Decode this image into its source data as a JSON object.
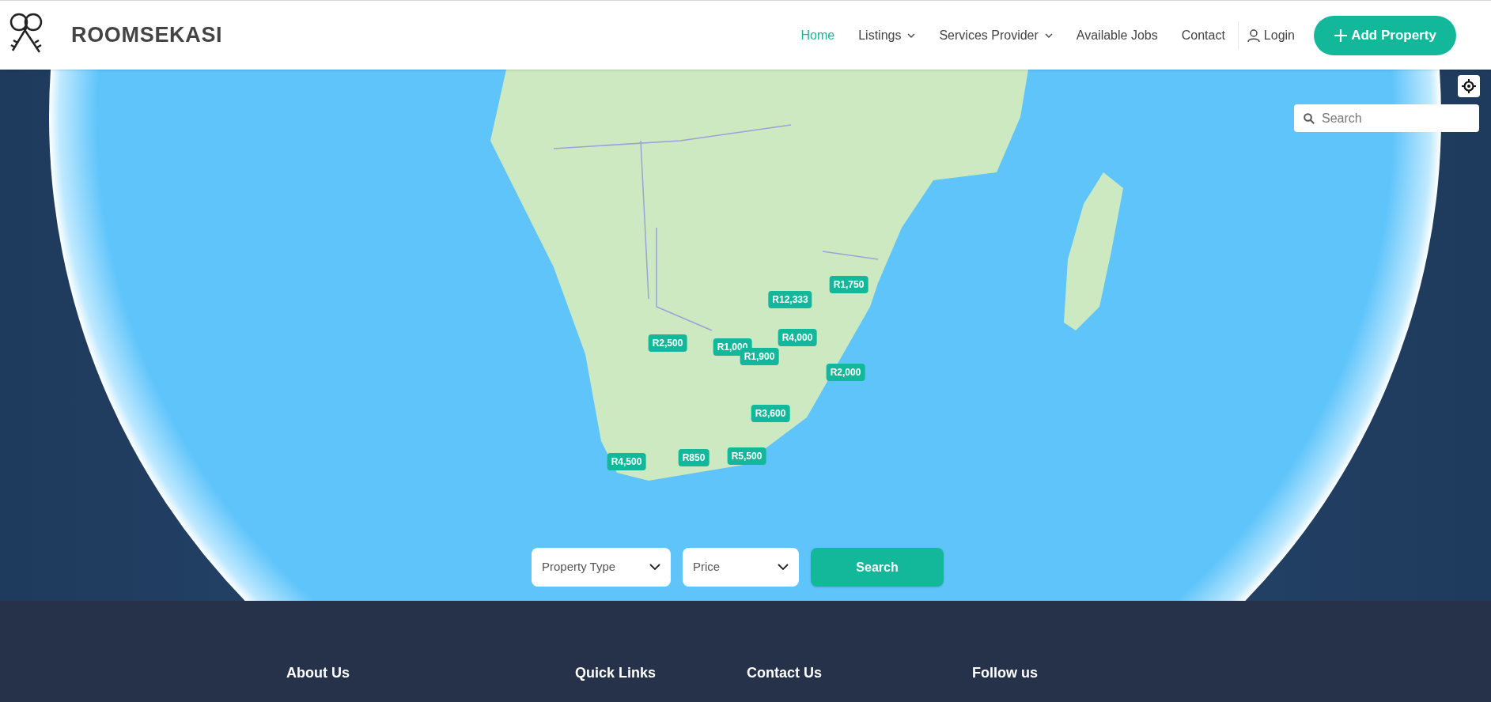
{
  "header": {
    "brand": "ROOMSEKASI",
    "nav": [
      {
        "label": "Home",
        "selected": true,
        "dropdown": false
      },
      {
        "label": "Listings",
        "selected": false,
        "dropdown": true
      },
      {
        "label": "Services Provider",
        "selected": false,
        "dropdown": true
      },
      {
        "label": "Available Jobs",
        "selected": false,
        "dropdown": false
      },
      {
        "label": "Contact",
        "selected": false,
        "dropdown": false
      }
    ],
    "login": "Login",
    "add_button": "Add Property"
  },
  "map": {
    "search": {
      "placeholder": "Search"
    },
    "markers": [
      {
        "label": "R1,750"
      },
      {
        "label": "R12,333"
      },
      {
        "label": "R2,500"
      },
      {
        "label": "R1,000"
      },
      {
        "label": "R1,900"
      },
      {
        "label": "R4,000"
      },
      {
        "label": "R2,000"
      },
      {
        "label": "R3,600"
      },
      {
        "label": "R850"
      },
      {
        "label": "R5,500"
      },
      {
        "label": "R4,500"
      }
    ]
  },
  "filters": {
    "property_type": "Property Type",
    "price": "Price",
    "search_button": "Search"
  },
  "footer": {
    "headings": [
      "About Us",
      "Quick Links",
      "Contact Us",
      "Follow us"
    ]
  }
}
